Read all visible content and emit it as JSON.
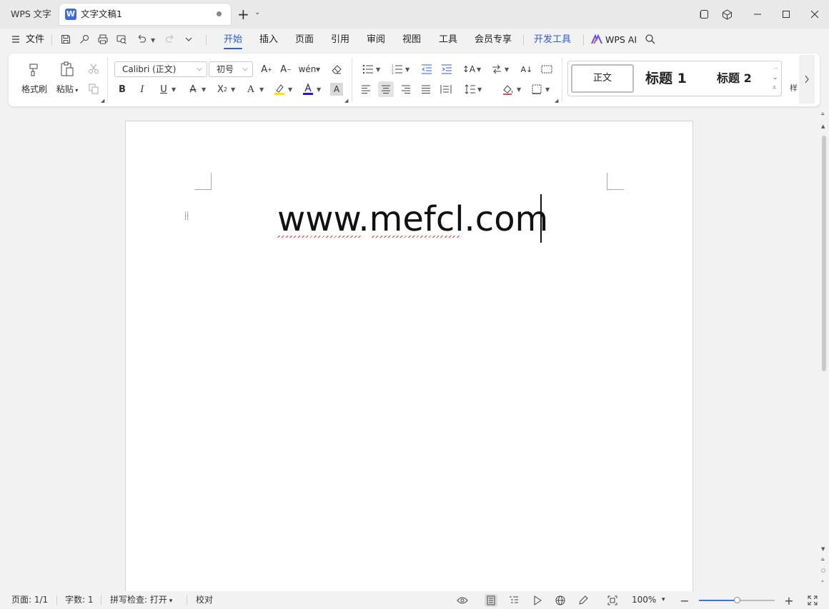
{
  "titlebar": {
    "app_tab": "WPS 文字",
    "doc_tab": "文字文稿1",
    "doc_icon_letter": "W"
  },
  "menubar": {
    "file": "文件",
    "tabs": [
      "开始",
      "插入",
      "页面",
      "引用",
      "审阅",
      "视图",
      "工具",
      "会员专享",
      "开发工具"
    ],
    "active_tab": "开始",
    "wps_ai": "WPS AI"
  },
  "ribbon": {
    "format_painter": "格式刷",
    "paste": "粘贴",
    "font_name": "Calibri (正文)",
    "font_size": "初号",
    "styles": {
      "normal": "正文",
      "heading1": "标题 1",
      "heading2": "标题 2",
      "more": "样"
    }
  },
  "document": {
    "text": "www.mefcl.com"
  },
  "statusbar": {
    "page": "页面: 1/1",
    "word_count": "字数: 1",
    "spell_check": "拼写检查: 打开",
    "proofread": "校对",
    "zoom": "100%",
    "zoom_level": 0.5
  },
  "colors": {
    "accent": "#2a5ed1",
    "highlight": "#ffe600",
    "font_color": "#1a1adf"
  }
}
